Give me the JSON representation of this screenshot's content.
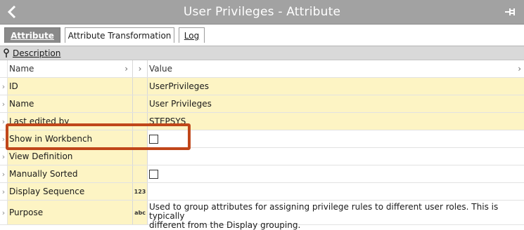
{
  "window": {
    "title": "User Privileges - Attribute",
    "back_icon": "chevron-left-icon",
    "pin_icon": "pin-icon"
  },
  "tabs": [
    {
      "label": "Attribute",
      "active": true
    },
    {
      "label": "Attribute Transformation",
      "active": false
    },
    {
      "label": "Log",
      "active": false
    }
  ],
  "section": {
    "label": "Description",
    "icon": "pin-icon"
  },
  "grid": {
    "header": {
      "name": "Name",
      "value": "Value"
    },
    "rows": [
      {
        "name": "ID",
        "type": "",
        "value": "UserPrivileges"
      },
      {
        "name": "Name",
        "type": "",
        "value": "User Privileges"
      },
      {
        "name": "Last edited by",
        "type": "",
        "value": "STEPSYS"
      },
      {
        "name": "Show in Workbench",
        "type": "",
        "value": ""
      },
      {
        "name": "View Definition",
        "type": "",
        "value": ""
      },
      {
        "name": "Manually Sorted",
        "type": "",
        "value": ""
      },
      {
        "name": "Display Sequence",
        "type": "123",
        "value": ""
      },
      {
        "name": "Purpose",
        "type": "abc",
        "value_line1": "Used to group attributes for assigning privilege rules to different user roles. This is typically",
        "value_line2": "different from the Display grouping."
      }
    ]
  },
  "colors": {
    "highlight": "#c0461a",
    "row_fill": "#fdf4c4",
    "titlebar": "#a2a2a2"
  }
}
